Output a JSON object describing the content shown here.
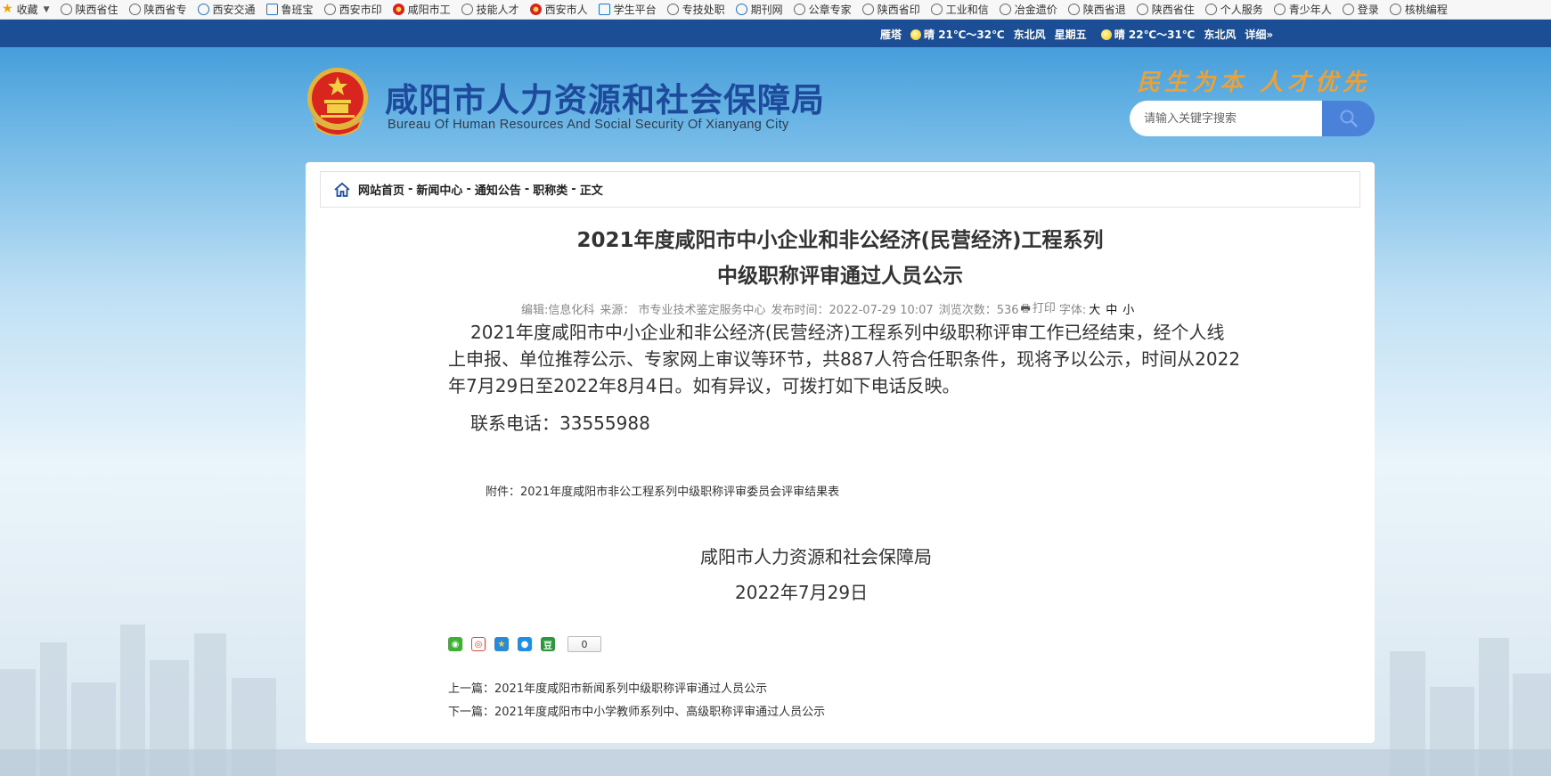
{
  "bookmarks": {
    "items": [
      {
        "label": "收藏",
        "icon": "star-icon"
      },
      {
        "label": "陕西省住",
        "icon": "globe-icon"
      },
      {
        "label": "陕西省专",
        "icon": "globe-icon"
      },
      {
        "label": "西安交通",
        "icon": "globe-icon"
      },
      {
        "label": "鲁班宝",
        "icon": "globe-icon"
      },
      {
        "label": "西安市印",
        "icon": "globe-icon"
      },
      {
        "label": "咸阳市工",
        "icon": "emblem-icon"
      },
      {
        "label": "技能人才",
        "icon": "globe-icon"
      },
      {
        "label": "西安市人",
        "icon": "emblem-icon"
      },
      {
        "label": "学生平台",
        "icon": "globe-icon"
      },
      {
        "label": "专技处职",
        "icon": "globe-icon"
      },
      {
        "label": "期刊网",
        "icon": "globe-icon"
      },
      {
        "label": "公章专家",
        "icon": "globe-icon"
      },
      {
        "label": "陕西省印",
        "icon": "globe-icon"
      },
      {
        "label": "工业和信",
        "icon": "globe-icon"
      },
      {
        "label": "冶金遗价",
        "icon": "globe-icon"
      },
      {
        "label": "陕西省退",
        "icon": "globe-icon"
      },
      {
        "label": "陕西省住",
        "icon": "globe-icon"
      },
      {
        "label": "个人服务",
        "icon": "globe-icon"
      },
      {
        "label": "青少年人",
        "icon": "globe-icon"
      },
      {
        "label": "登录",
        "icon": "globe-icon"
      },
      {
        "label": "核桃编程",
        "icon": "globe-icon"
      }
    ]
  },
  "weather": {
    "city": "雁塔",
    "today": "晴 21℃～32℃",
    "today_wind": "东北风",
    "weekday": "星期五",
    "tomorrow": "晴 22℃～31℃",
    "tomorrow_wind": "东北风",
    "detail": "详细»"
  },
  "header": {
    "title": "咸阳市人力资源和社会保障局",
    "subtitle": "Bureau Of Human Resources And Social Security Of Xianyang City",
    "slogan": "民生为本  人才优先",
    "search_placeholder": "请输入关键字搜索"
  },
  "breadcrumb": {
    "items": [
      "网站首页",
      "新闻中心",
      "通知公告",
      "职称类",
      "正文"
    ],
    "separator": "-"
  },
  "article": {
    "title_line1": "2021年度咸阳市中小企业和非公经济(民营经济)工程系列",
    "title_line2": "中级职称评审通过人员公示",
    "editor": "编辑:信息化科",
    "source": "来源：  市专业技术鉴定服务中心",
    "published": "发布时间：2022-07-29 10:07",
    "views": "浏览次数：536",
    "print": "打印",
    "font_label": "字体:",
    "font_sizes": [
      "大",
      "中",
      "小"
    ],
    "body": "2021年度咸阳市中小企业和非公经济(民营经济)工程系列中级职称评审工作已经结束，经个人线上申报、单位推荐公示、专家网上审议等环节，共887人符合任职条件，现将予以公示，时间从2022年7月29日至2022年8月4日。如有异议，可拨打如下电话反映。",
    "phone": "联系电话：33555988",
    "attachment": "附件：2021年度咸阳市非公工程系列中级职称评审委员会评审结果表",
    "sign_org": "咸阳市人力资源和社会保障局",
    "sign_date": "2022年7月29日",
    "share_count": "0",
    "prev": "上一篇：2021年度咸阳市新闻系列中级职称评审通过人员公示",
    "next": "下一篇：2021年度咸阳市中小学教师系列中、高级职称评审通过人员公示"
  },
  "colors": {
    "title_blue": "#1d4a9a",
    "strip_blue": "#1c4e96",
    "slogan_gold": "#e9a13a",
    "search_button": "#4b82d9"
  }
}
